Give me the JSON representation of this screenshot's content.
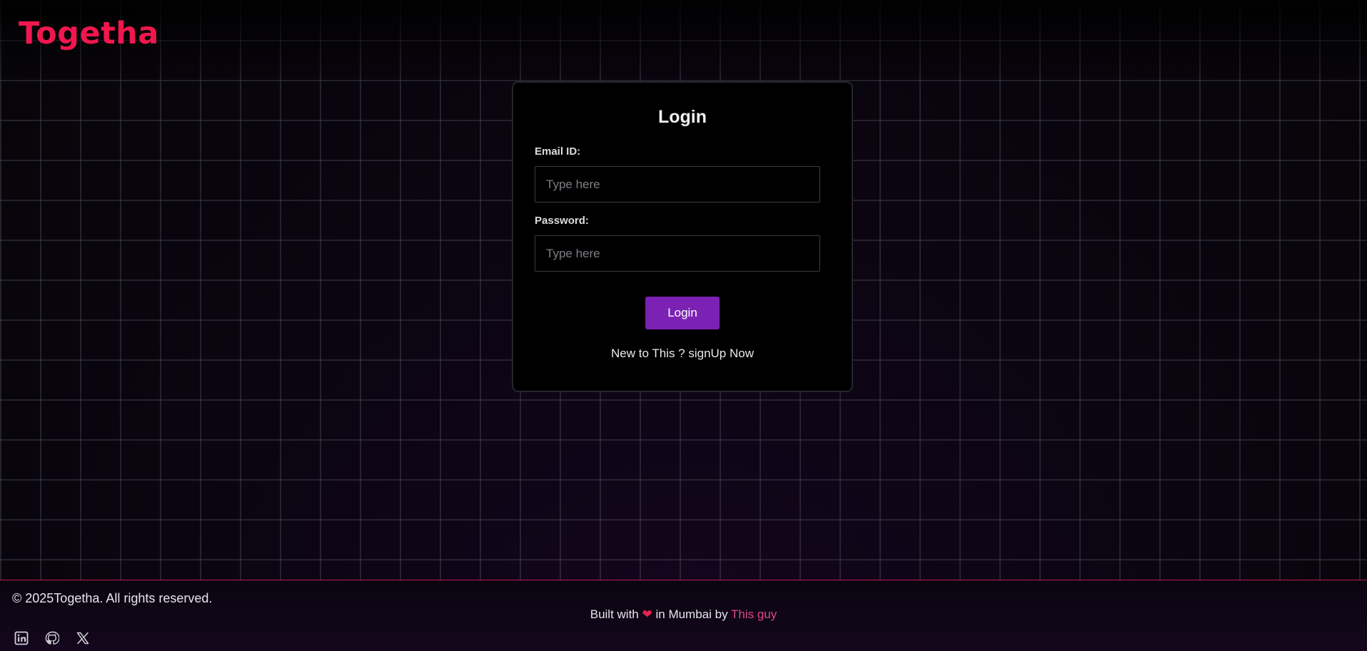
{
  "header": {
    "logo_text": "Togetha"
  },
  "login_card": {
    "title": "Login",
    "email_label": "Email ID:",
    "email_placeholder": "Type here",
    "email_value": "",
    "password_label": "Password:",
    "password_placeholder": "Type here",
    "password_value": "",
    "login_button": "Login",
    "signup_text": "New to This ? signUp Now"
  },
  "footer": {
    "copyright": "© 2025Togetha. All rights reserved.",
    "built_prefix": "Built with",
    "built_middle": "in Mumbai by",
    "author_link": "This guy",
    "socials": [
      "linkedin-icon",
      "github-icon",
      "x-icon"
    ]
  },
  "colors": {
    "brand": "#f0174f",
    "button": "#7b22b4",
    "link": "#e0488a",
    "heart": "#e8214f"
  }
}
